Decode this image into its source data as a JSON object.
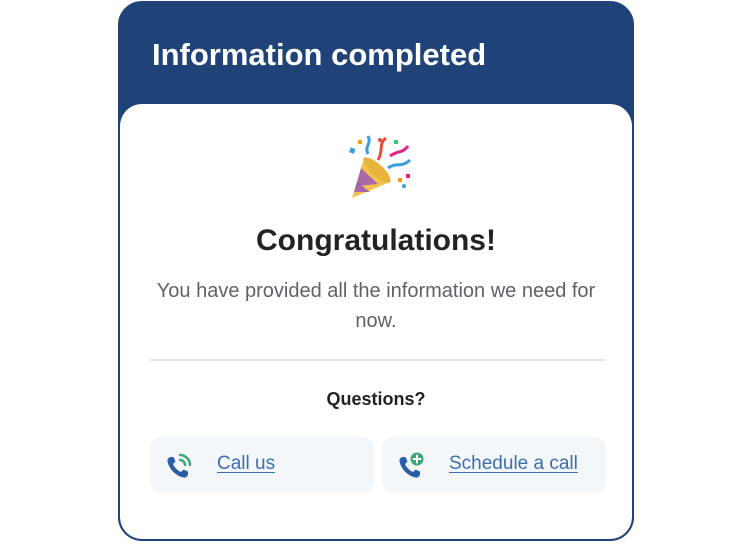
{
  "header": {
    "title": "Information completed"
  },
  "main": {
    "icon": "party-popper-icon",
    "heading": "Congratulations!",
    "message": "You have provided all the information we need for now."
  },
  "questions": {
    "heading": "Questions?",
    "actions": [
      {
        "label": "Call us",
        "icon": "phone-ringing-icon"
      },
      {
        "label": "Schedule a call",
        "icon": "phone-add-icon"
      }
    ]
  },
  "colors": {
    "header_bg": "#1f4378",
    "link": "#3a6fb0",
    "icon_blue": "#2a5fa8",
    "icon_green": "#3aa876",
    "action_bg": "#f4f7f9"
  }
}
